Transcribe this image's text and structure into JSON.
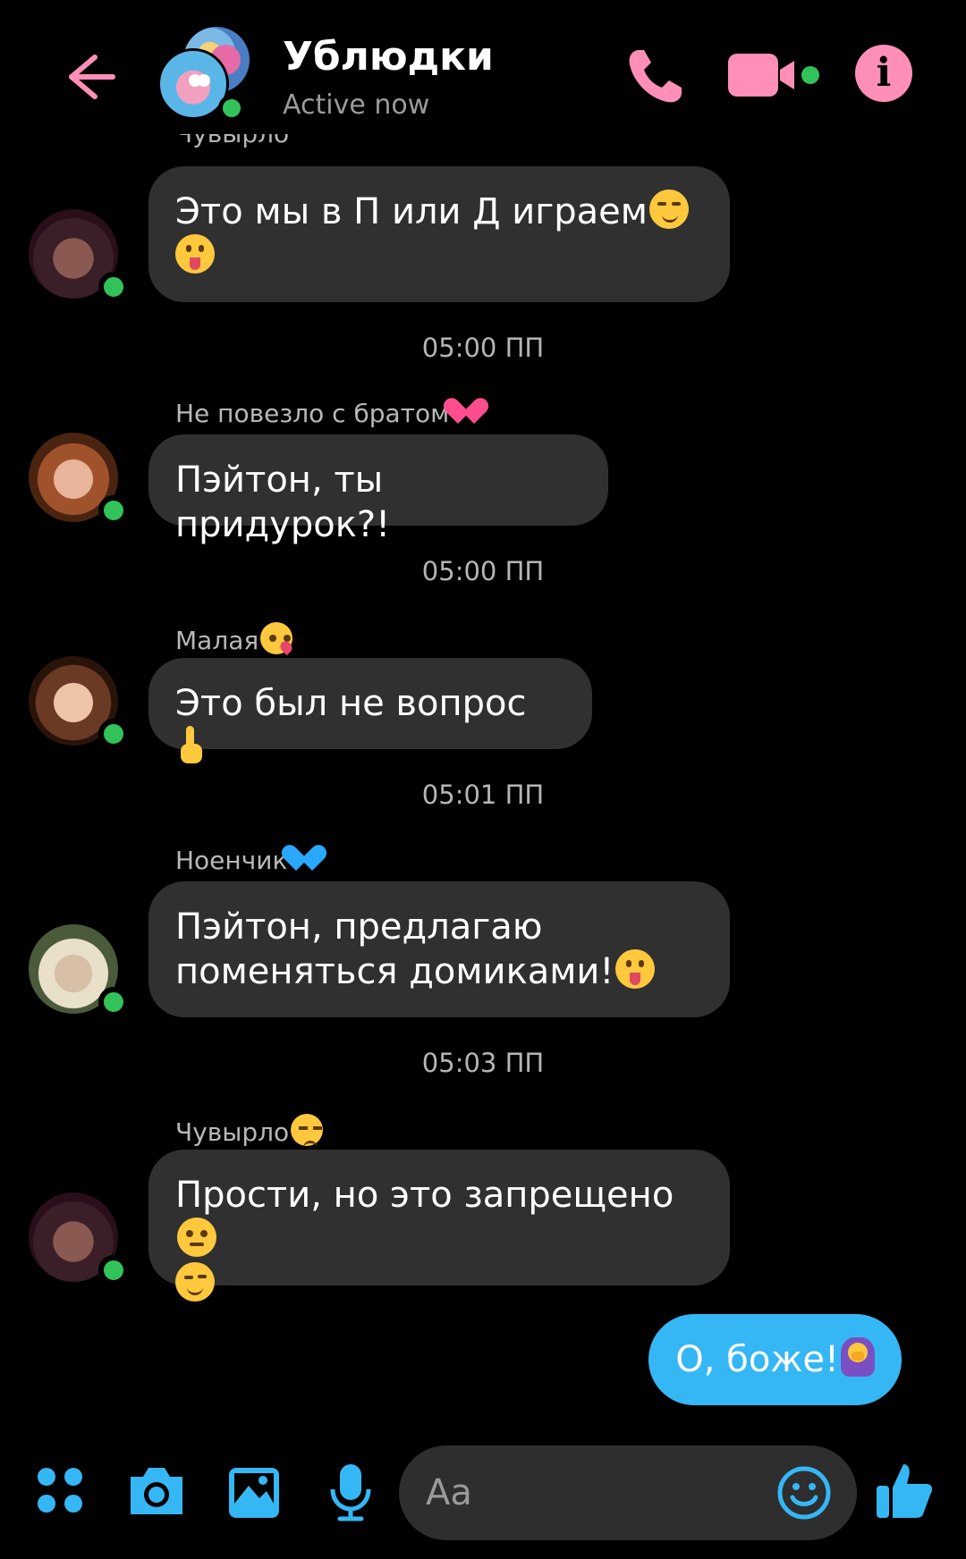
{
  "header": {
    "title": "Ублюдки",
    "status": "Active now"
  },
  "colors": {
    "accent_pink": "#ff8fb8",
    "accent_blue": "#35b7f5",
    "online_green": "#31c35a",
    "bubble_gray": "#303030",
    "background": "#000000"
  },
  "cut_sender": "Чувырло",
  "messages": [
    {
      "sender": "",
      "text": "Это мы в П или Д играем",
      "emojis": [
        "smirk",
        "tongue"
      ]
    },
    {
      "time": "05:00 ПП"
    },
    {
      "sender": "Не повезло с братом",
      "sender_emoji": "heart-pink",
      "text": "Пэйтон, ты придурок?!"
    },
    {
      "time": "05:00 ПП"
    },
    {
      "sender": "Малая",
      "sender_emoji": "kiss",
      "text": "Это был не вопрос",
      "emojis": [
        "finger"
      ]
    },
    {
      "time": "05:01 ПП"
    },
    {
      "sender": "Ноенчик",
      "sender_emoji": "heart-blue",
      "text_line1": "Пэйтон, предлагаю",
      "text_line2": "поменяться домиками!",
      "emojis": [
        "tongue"
      ]
    },
    {
      "time": "05:03 ПП"
    },
    {
      "sender": "Чувырло",
      "sender_emoji": "unamused",
      "text": "Прости, но это запрещено",
      "emojis": [
        "neutral",
        "wink"
      ]
    }
  ],
  "outgoing": {
    "text": "О, боже!",
    "emoji": "facepalm"
  },
  "composer": {
    "placeholder": "Aa",
    "icons": [
      "apps-icon",
      "camera-icon",
      "gallery-icon",
      "microphone-icon",
      "emoji-icon",
      "like-icon"
    ]
  }
}
